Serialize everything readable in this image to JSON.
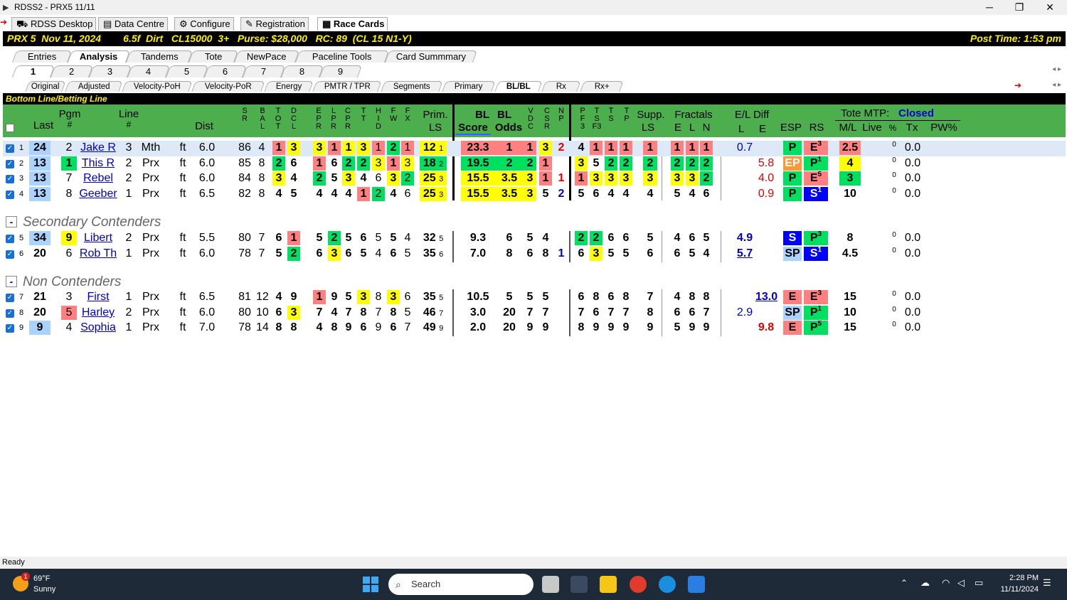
{
  "window": {
    "title": "RDSS2 - PRX5  11/11",
    "minimize": "─",
    "maximize": "❐",
    "close": "✕"
  },
  "app_tabs": [
    {
      "label": "RDSS Desktop",
      "icon": "person-icon"
    },
    {
      "label": "Data Centre",
      "icon": "database-icon"
    },
    {
      "label": "Configure",
      "icon": "gear-icon"
    },
    {
      "label": "Registration",
      "icon": "registration-icon"
    },
    {
      "label": "Race Cards",
      "icon": "card-icon"
    }
  ],
  "race_info": {
    "left": "PRX 5  Nov 11, 2024        6.5f  Dirt   CL15000  3+   Purse: $28,000   RC: 89  (CL 15 N1-Y)",
    "right": "Post Time: 1:53 pm"
  },
  "view_tabs": [
    "Entries",
    "Analysis",
    "Tandems",
    "Tote",
    "NewPace",
    "Paceline Tools",
    "Card Summmary"
  ],
  "race_tabs": [
    "1",
    "2",
    "3",
    "4",
    "5",
    "6",
    "7",
    "8",
    "9"
  ],
  "sub_tabs": [
    "Original",
    "Adjusted",
    "Velocity-PoH",
    "Velocity-PoR",
    "Energy",
    "PMTR / TPR",
    "Segments",
    "Primary",
    "BL/BL",
    "Rx",
    "Rx+"
  ],
  "section_title": "Bottom Line/Betting Line",
  "headers": {
    "pgm": "Pgm",
    "pgm2": "#",
    "last": "Last",
    "line": "Line",
    "line2": "#",
    "dist": "Dist",
    "sr": "S\nR",
    "bal": "B\nA\nL",
    "tot": "T\nO\nT",
    "dcl": "D\nC\nL",
    "epr": "E\nP\nR",
    "lpr": "L\nP\nR",
    "cpr": "C\nP\nR",
    "tt": "T\nT",
    "hid": "H\nI\nD",
    "fw": "F\nW",
    "fx": "F\nX",
    "prim": "Prim.",
    "prim_ls": "LS",
    "bl": "BL",
    "bl_score": "Score",
    "bl2": "BL",
    "bl_odds": "Odds",
    "vdc": "V\nD\nC",
    "csr": "C\nS\nR",
    "np": "N\nP",
    "pf3": "P\nF\n3",
    "tsf3": "T\nS\nF3",
    "ts": "T\nS",
    "tp": "T\nP",
    "supp": "Supp.",
    "supp_ls": "LS",
    "fractals": "Fractals",
    "fe": "E",
    "fl": "L",
    "fn": "N",
    "el_diff": "E/L Diff",
    "el_l": "L",
    "el_e": "E",
    "esp": "ESP",
    "rs": "RS",
    "tote_mtp": "Tote MTP:",
    "tote_status": "Closed",
    "ml": "M/L",
    "live": "Live",
    "pct": "%",
    "tx": "Tx",
    "pw": "PW%"
  },
  "groups": [
    {
      "label": "Secondary Contenders"
    },
    {
      "label": "Non Contenders"
    }
  ],
  "rows": [
    {
      "n": "1",
      "last": "24",
      "pgm": "2",
      "name": "Jake R",
      "line": "3",
      "trk": "Mth",
      "surf": "ft",
      "dist": "6.0",
      "sr": "86",
      "bal": "4",
      "tot": "1",
      "dcl": "3",
      "epr": "3",
      "lpr": "1",
      "cpr": "1",
      "tt": "3",
      "hid": "1",
      "fw": "2",
      "fx": "1",
      "prim": "12",
      "prim_s": "1",
      "score": "23.3",
      "odds": "1",
      "vdc": "1",
      "csr": "3",
      "np": "2",
      "pf3": "4",
      "tsf3": "1",
      "ts": "1",
      "tp": "1",
      "supp": "1",
      "fe": "1",
      "fl": "1",
      "fn": "1",
      "el_l": "0.7",
      "el_e": "",
      "esp": "P",
      "rs": "E",
      "rs_s": "3",
      "ml": "2.5",
      "live_s": "0",
      "tx": "0.0"
    },
    {
      "n": "2",
      "last": "13",
      "pgm": "1",
      "name": "This R",
      "line": "2",
      "trk": "Prx",
      "surf": "ft",
      "dist": "6.0",
      "sr": "85",
      "bal": "8",
      "tot": "2",
      "dcl": "6",
      "epr": "1",
      "lpr": "6",
      "cpr": "2",
      "tt": "2",
      "hid": "3",
      "fw": "1",
      "fx": "3",
      "prim": "18",
      "prim_s": "2",
      "score": "19.5",
      "odds": "2",
      "vdc": "2",
      "csr": "1",
      "np": "",
      "pf3": "3",
      "tsf3": "5",
      "ts": "2",
      "tp": "2",
      "supp": "2",
      "fe": "2",
      "fl": "2",
      "fn": "2",
      "el_l": "",
      "el_e": "5.8",
      "esp": "EP",
      "rs": "P",
      "rs_s": "1",
      "ml": "4",
      "live_s": "0",
      "tx": "0.0"
    },
    {
      "n": "3",
      "last": "13",
      "pgm": "7",
      "name": "Rebel",
      "line": "2",
      "trk": "Prx",
      "surf": "ft",
      "dist": "6.0",
      "sr": "84",
      "bal": "8",
      "tot": "3",
      "dcl": "4",
      "epr": "2",
      "lpr": "5",
      "cpr": "3",
      "tt": "4",
      "hid": "6",
      "fw": "3",
      "fx": "2",
      "prim": "25",
      "prim_s": "3",
      "score": "15.5",
      "odds": "3.5",
      "vdc": "3",
      "csr": "1",
      "np": "1",
      "pf3": "1",
      "tsf3": "3",
      "ts": "3",
      "tp": "3",
      "supp": "3",
      "fe": "3",
      "fl": "3",
      "fn": "2",
      "el_l": "",
      "el_e": "4.0",
      "esp": "P",
      "rs": "E",
      "rs_s": "5",
      "ml": "3",
      "live_s": "0",
      "tx": "0.0"
    },
    {
      "n": "4",
      "last": "13",
      "pgm": "8",
      "name": "Geeber",
      "line": "1",
      "trk": "Prx",
      "surf": "ft",
      "dist": "6.5",
      "sr": "82",
      "bal": "8",
      "tot": "4",
      "dcl": "5",
      "epr": "4",
      "lpr": "4",
      "cpr": "4",
      "tt": "1",
      "hid": "2",
      "fw": "4",
      "fx": "6",
      "prim": "25",
      "prim_s": "3",
      "score": "15.5",
      "odds": "3.5",
      "vdc": "3",
      "csr": "5",
      "np": "2",
      "pf3": "5",
      "tsf3": "6",
      "ts": "4",
      "tp": "4",
      "supp": "4",
      "fe": "5",
      "fl": "4",
      "fn": "6",
      "el_l": "",
      "el_e": "0.9",
      "esp": "P",
      "rs": "S",
      "rs_s": "1",
      "ml": "10",
      "live_s": "0",
      "tx": "0.0"
    },
    {
      "n": "5",
      "last": "34",
      "pgm": "9",
      "name": "Libert",
      "line": "2",
      "trk": "Prx",
      "surf": "ft",
      "dist": "5.5",
      "sr": "80",
      "bal": "7",
      "tot": "6",
      "dcl": "1",
      "epr": "5",
      "lpr": "2",
      "cpr": "5",
      "tt": "6",
      "hid": "5",
      "fw": "5",
      "fx": "4",
      "prim": "32",
      "prim_s": "5",
      "score": "9.3",
      "odds": "6",
      "vdc": "5",
      "csr": "4",
      "np": "",
      "pf3": "2",
      "tsf3": "2",
      "ts": "6",
      "tp": "6",
      "supp": "5",
      "fe": "4",
      "fl": "6",
      "fn": "5",
      "el_l": "4.9",
      "el_e": "",
      "esp": "S",
      "rs": "P",
      "rs_s": "3",
      "ml": "8",
      "live_s": "0",
      "tx": "0.0"
    },
    {
      "n": "6",
      "last": "20",
      "pgm": "6",
      "name": "Rob Th",
      "line": "1",
      "trk": "Prx",
      "surf": "ft",
      "dist": "6.0",
      "sr": "78",
      "bal": "7",
      "tot": "5",
      "dcl": "2",
      "epr": "6",
      "lpr": "3",
      "cpr": "6",
      "tt": "5",
      "hid": "4",
      "fw": "6",
      "fx": "5",
      "prim": "35",
      "prim_s": "6",
      "score": "7.0",
      "odds": "8",
      "vdc": "6",
      "csr": "8",
      "np": "1",
      "pf3": "6",
      "tsf3": "3",
      "ts": "5",
      "tp": "5",
      "supp": "6",
      "fe": "6",
      "fl": "5",
      "fn": "4",
      "el_l": "5.7",
      "el_e": "",
      "esp": "SP",
      "rs": "S",
      "rs_s": "1",
      "ml": "4.5",
      "live_s": "0",
      "tx": "0.0"
    },
    {
      "n": "7",
      "last": "21",
      "pgm": "3",
      "name": "First",
      "line": "1",
      "trk": "Prx",
      "surf": "ft",
      "dist": "6.5",
      "sr": "81",
      "bal": "12",
      "tot": "4",
      "dcl": "9",
      "epr": "1",
      "lpr": "9",
      "cpr": "5",
      "tt": "3",
      "hid": "8",
      "fw": "3",
      "fx": "6",
      "prim": "35",
      "prim_s": "5",
      "score": "10.5",
      "odds": "5",
      "vdc": "5",
      "csr": "5",
      "np": "",
      "pf3": "6",
      "tsf3": "8",
      "ts": "6",
      "tp": "8",
      "supp": "7",
      "fe": "4",
      "fl": "8",
      "fn": "8",
      "el_l": "",
      "el_e": "13.0",
      "esp": "E",
      "rs": "E",
      "rs_s": "3",
      "ml": "15",
      "live_s": "0",
      "tx": "0.0"
    },
    {
      "n": "8",
      "last": "20",
      "pgm": "5",
      "name": "Harley",
      "line": "2",
      "trk": "Prx",
      "surf": "ft",
      "dist": "6.0",
      "sr": "80",
      "bal": "10",
      "tot": "6",
      "dcl": "3",
      "epr": "7",
      "lpr": "4",
      "cpr": "7",
      "tt": "8",
      "hid": "7",
      "fw": "8",
      "fx": "5",
      "prim": "46",
      "prim_s": "7",
      "score": "3.0",
      "odds": "20",
      "vdc": "7",
      "csr": "7",
      "np": "",
      "pf3": "7",
      "tsf3": "6",
      "ts": "7",
      "tp": "7",
      "supp": "8",
      "fe": "6",
      "fl": "6",
      "fn": "7",
      "el_l": "2.9",
      "el_e": "",
      "esp": "SP",
      "rs": "P",
      "rs_s": "1",
      "ml": "10",
      "live_s": "0",
      "tx": "0.0"
    },
    {
      "n": "9",
      "last": "9",
      "pgm": "4",
      "name": "Sophia",
      "line": "1",
      "trk": "Prx",
      "surf": "ft",
      "dist": "7.0",
      "sr": "78",
      "bal": "14",
      "tot": "8",
      "dcl": "8",
      "epr": "4",
      "lpr": "8",
      "cpr": "9",
      "tt": "6",
      "hid": "9",
      "fw": "6",
      "fx": "7",
      "prim": "49",
      "prim_s": "9",
      "score": "2.0",
      "odds": "20",
      "vdc": "9",
      "csr": "9",
      "np": "",
      "pf3": "8",
      "tsf3": "9",
      "ts": "9",
      "tp": "9",
      "supp": "9",
      "fe": "5",
      "fl": "9",
      "fn": "9",
      "el_l": "",
      "el_e": "9.8",
      "esp": "E",
      "rs": "P",
      "rs_s": "5",
      "ml": "15",
      "live_s": "0",
      "tx": "0.0"
    }
  ],
  "status": "Ready",
  "taskbar": {
    "temp": "69°F",
    "weather": "Sunny",
    "weather_badge": "1",
    "search": "Search",
    "time": "2:28 PM",
    "date": "11/11/2024"
  }
}
